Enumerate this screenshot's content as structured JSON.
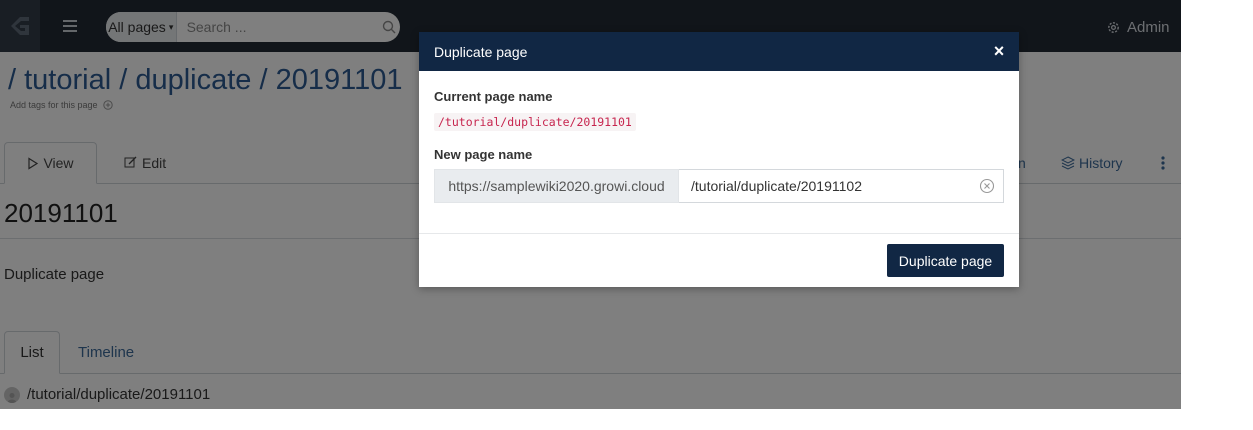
{
  "navbar": {
    "menu_icon": "hamburger-icon",
    "search": {
      "scope_label": "All pages",
      "placeholder": "Search ...",
      "icon": "search-icon"
    },
    "admin_label": "Admin",
    "admin_icon": "gear-icon"
  },
  "page": {
    "path": "/ tutorial / duplicate / 20191101",
    "tags_hint": "Add tags for this page",
    "tabs": {
      "view": "View",
      "edit": "Edit",
      "partial": "n",
      "history": "History"
    },
    "title": "20191101",
    "body_text": "Duplicate page",
    "list_tabs": {
      "list": "List",
      "timeline": "Timeline"
    },
    "list_items": [
      "/tutorial/duplicate/20191101"
    ]
  },
  "modal": {
    "title": "Duplicate page",
    "current_label": "Current page name",
    "current_value": "/tutorial/duplicate/20191101",
    "new_label": "New page name",
    "url_prefix": "https://samplewiki2020.growi.cloud",
    "new_value": "/tutorial/duplicate/20191102",
    "submit_label": "Duplicate page",
    "close_glyph": "×"
  },
  "colors": {
    "navbar": "#222b35",
    "modal_header": "#112744",
    "link": "#2c5a92",
    "code_text": "#c7254e"
  }
}
